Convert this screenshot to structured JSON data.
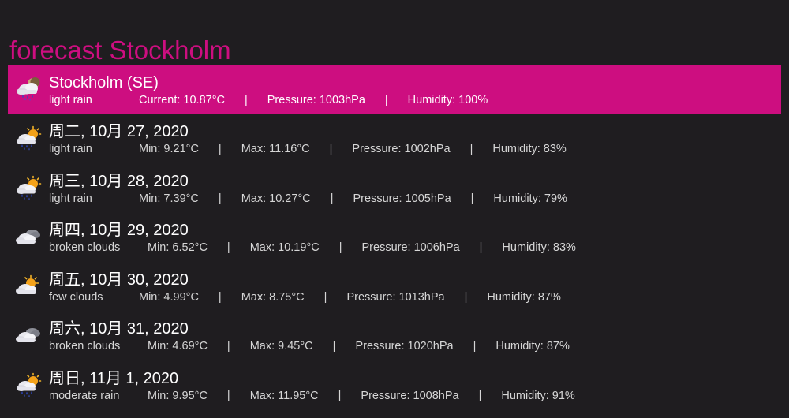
{
  "page": {
    "title": "forecast Stockholm"
  },
  "current": {
    "title": "Stockholm (SE)",
    "description": "light rain",
    "current": "Current: 10.87°C",
    "pressure": "Pressure: 1003hPa",
    "humidity": "Humidity: 100%",
    "icon": "rain-night-icon"
  },
  "separator": "|",
  "days": [
    {
      "date": "周二, 10月 27, 2020",
      "description": "light rain",
      "min": "Min: 9.21°C",
      "max": "Max: 11.16°C",
      "pressure": "Pressure: 1002hPa",
      "humidity": "Humidity: 83%",
      "icon": "rain-sun-icon"
    },
    {
      "date": "周三, 10月 28, 2020",
      "description": "light rain",
      "min": "Min: 7.39°C",
      "max": "Max: 10.27°C",
      "pressure": "Pressure: 1005hPa",
      "humidity": "Humidity: 79%",
      "icon": "rain-sun-icon"
    },
    {
      "date": "周四, 10月 29, 2020",
      "description": "broken clouds",
      "min": "Min: 6.52°C",
      "max": "Max: 10.19°C",
      "pressure": "Pressure: 1006hPa",
      "humidity": "Humidity: 83%",
      "icon": "broken-clouds-icon"
    },
    {
      "date": "周五, 10月 30, 2020",
      "description": "few clouds",
      "min": "Min: 4.99°C",
      "max": "Max: 8.75°C",
      "pressure": "Pressure: 1013hPa",
      "humidity": "Humidity: 87%",
      "icon": "few-clouds-icon"
    },
    {
      "date": "周六, 10月 31, 2020",
      "description": "broken clouds",
      "min": "Min: 4.69°C",
      "max": "Max: 9.45°C",
      "pressure": "Pressure: 1020hPa",
      "humidity": "Humidity: 87%",
      "icon": "broken-clouds-icon"
    },
    {
      "date": "周日, 11月 1, 2020",
      "description": "moderate rain",
      "min": "Min: 9.95°C",
      "max": "Max: 11.95°C",
      "pressure": "Pressure: 1008hPa",
      "humidity": "Humidity: 91%",
      "icon": "rain-sun-icon"
    }
  ],
  "colors": {
    "accent": "#cd0e80",
    "background": "#1f1d20",
    "text": "#ffffff",
    "muted_text": "#d6d6d6"
  }
}
